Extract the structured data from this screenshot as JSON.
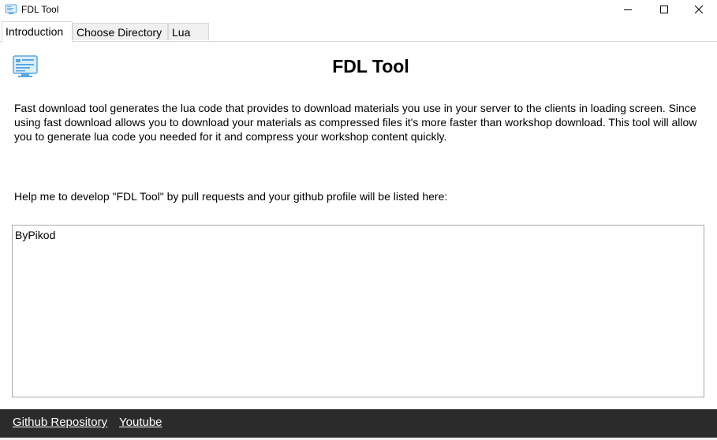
{
  "window": {
    "title": "FDL Tool",
    "controls": {
      "minimize": "minimize-icon",
      "maximize": "maximize-icon",
      "close": "close-icon"
    }
  },
  "tabs": [
    {
      "label": "Introduction",
      "active": true
    },
    {
      "label": "Choose Directory",
      "active": false
    },
    {
      "label": "Lua",
      "active": false
    }
  ],
  "intro": {
    "icon": "app-screen-icon",
    "title": "FDL Tool",
    "description": "Fast download tool generates the lua code that provides to download materials you use in your server to the clients in loading screen. Since using fast download allows you to download your materials as compressed files it's more faster than workshop download. This tool will allow you to generate lua code you needed for it and compress your workshop content quickly.",
    "help_text": "Help me to develop \"FDL Tool\" by pull requests and your github profile will be listed here:",
    "contributors": "ByPikod"
  },
  "footer": {
    "github_label": "Github Repository",
    "youtube_label": "Youtube"
  },
  "colors": {
    "footer_bg": "#2b2b2b",
    "icon_blue": "#5aa7e0"
  }
}
